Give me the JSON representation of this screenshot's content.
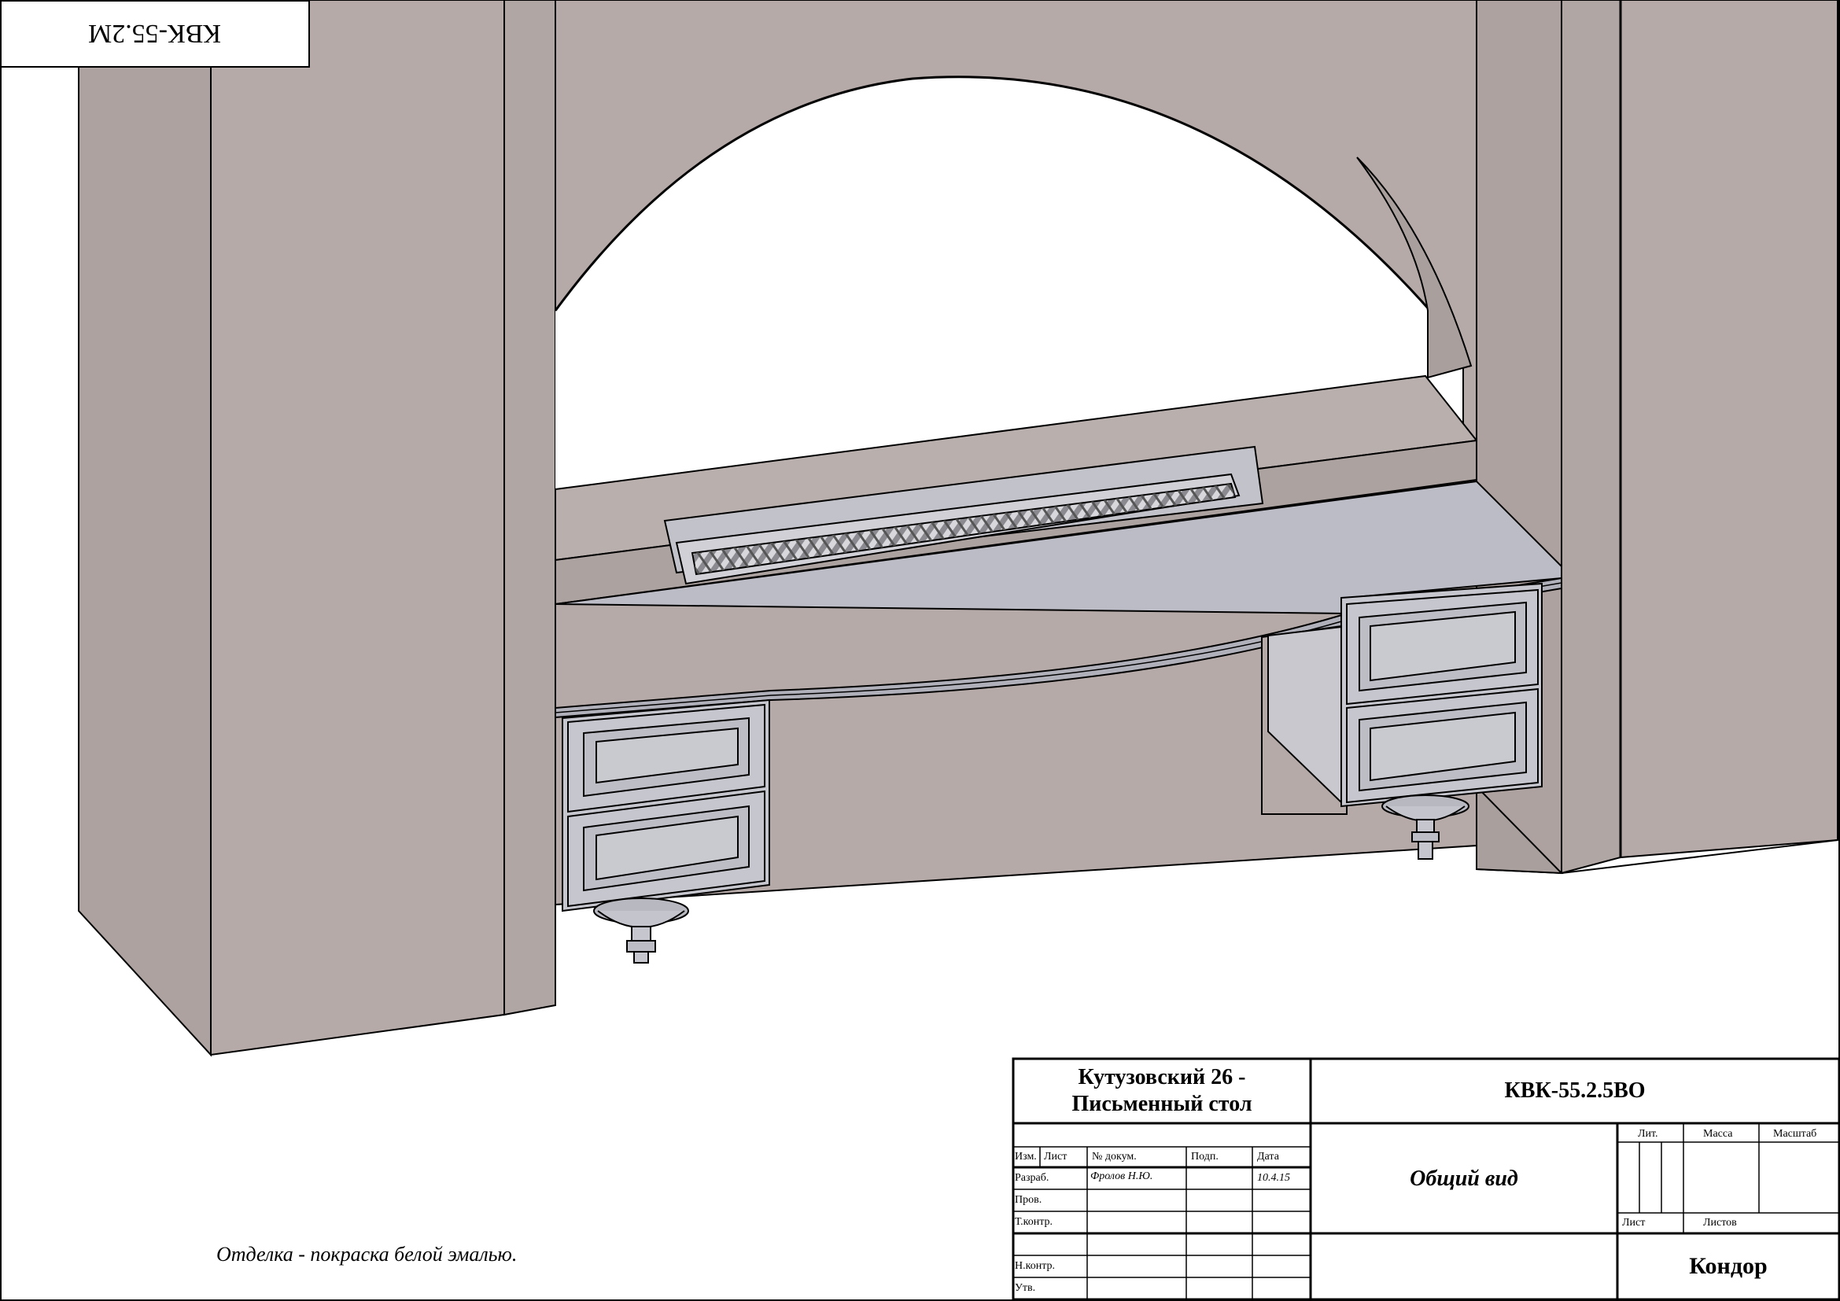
{
  "stamp": {
    "code_rotated": "КВК-55.2М"
  },
  "title_block": {
    "title_line1": "Кутузовский 26 -",
    "title_line2": "Письменный стол",
    "doc_code": "КВК-55.2.5ВО",
    "view_name": "Общий вид",
    "organization": "Кондор",
    "col_headers": {
      "izm": "Изм.",
      "list": "Лист",
      "doc_no": "№ докум.",
      "sign": "Подп.",
      "date": "Дата"
    },
    "rows": {
      "developed": "Разраб.",
      "checked": "Пров.",
      "tech_control": "Т.контр.",
      "norm_control": "Н.контр.",
      "approved": "Утв."
    },
    "developer_name": "Фролов Н.Ю.",
    "develop_date": "10.4.15",
    "right_headers": {
      "lit": "Лит.",
      "mass": "Масса",
      "scale": "Масштаб"
    },
    "sheet_label": "Лист",
    "sheets_label": "Листов"
  },
  "note": "Отделка - покраска белой эмалью.",
  "colors": {
    "wall": "#b5aaa8",
    "wall_dark": "#a99f9c",
    "desk_top": "#bcbcc6",
    "desk_face": "#c6c6ce",
    "line": "#000000"
  }
}
